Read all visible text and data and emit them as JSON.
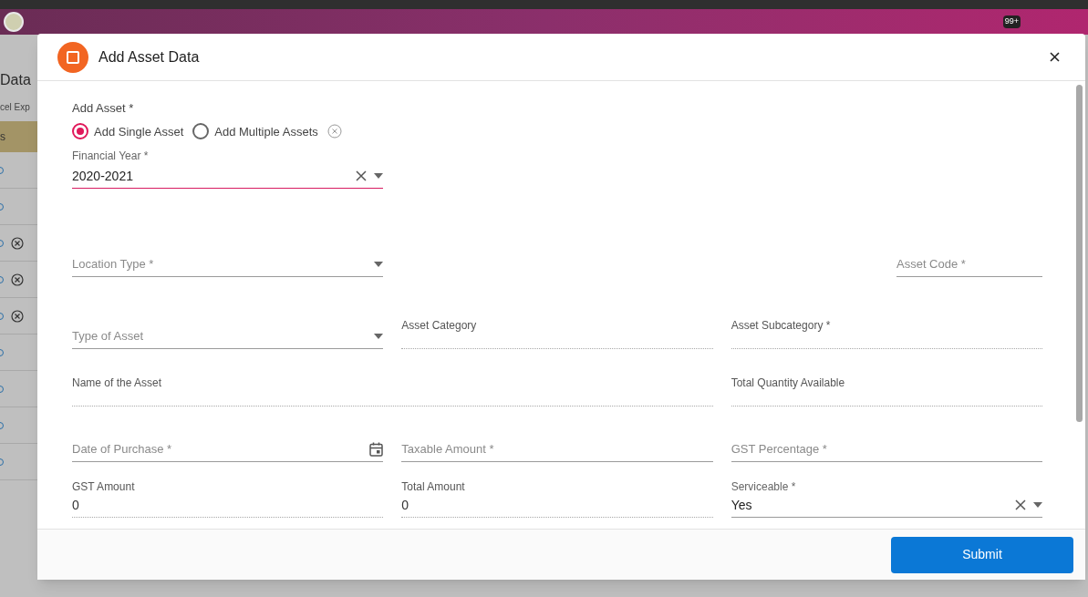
{
  "background_page": {
    "heading": "Data",
    "toolbar_button": "cel Exp",
    "table_header": "s",
    "rows": [
      {
        "removable": false
      },
      {
        "removable": false
      },
      {
        "removable": true
      },
      {
        "removable": true
      },
      {
        "removable": true
      },
      {
        "removable": false
      },
      {
        "removable": false
      },
      {
        "removable": false
      },
      {
        "removable": false
      }
    ],
    "notification_badge": "99+"
  },
  "dialog": {
    "title": "Add Asset Data",
    "add_asset": {
      "label": "Add Asset *",
      "options": [
        {
          "label": "Add Single Asset",
          "selected": true
        },
        {
          "label": "Add Multiple Assets",
          "selected": false
        }
      ]
    },
    "financial_year": {
      "label": "Financial Year *",
      "value": "2020-2021",
      "focused": true
    },
    "fields": [
      {
        "kind": "select",
        "placeholder": "Location Type *"
      },
      {
        "kind": "input",
        "placeholder": "Asset Code *"
      },
      {
        "kind": "select",
        "placeholder": "Type of Asset"
      },
      {
        "kind": "readonly",
        "label": "Asset Category"
      },
      {
        "kind": "readonly",
        "label": "Asset Subcategory *"
      },
      {
        "kind": "readonly",
        "label": "Name of the Asset"
      },
      {
        "kind": "readonly",
        "label": "Total Quantity Available"
      },
      {
        "kind": "date",
        "placeholder": "Date of Purchase *"
      },
      {
        "kind": "input",
        "placeholder": "Taxable Amount *"
      },
      {
        "kind": "input",
        "placeholder": "GST Percentage *"
      },
      {
        "kind": "readonly",
        "label": "GST Amount",
        "value": "0"
      },
      {
        "kind": "readonly",
        "label": "Total Amount",
        "value": "0"
      },
      {
        "kind": "select",
        "label": "Serviceable *",
        "value": "Yes"
      }
    ],
    "submit": "Submit"
  }
}
